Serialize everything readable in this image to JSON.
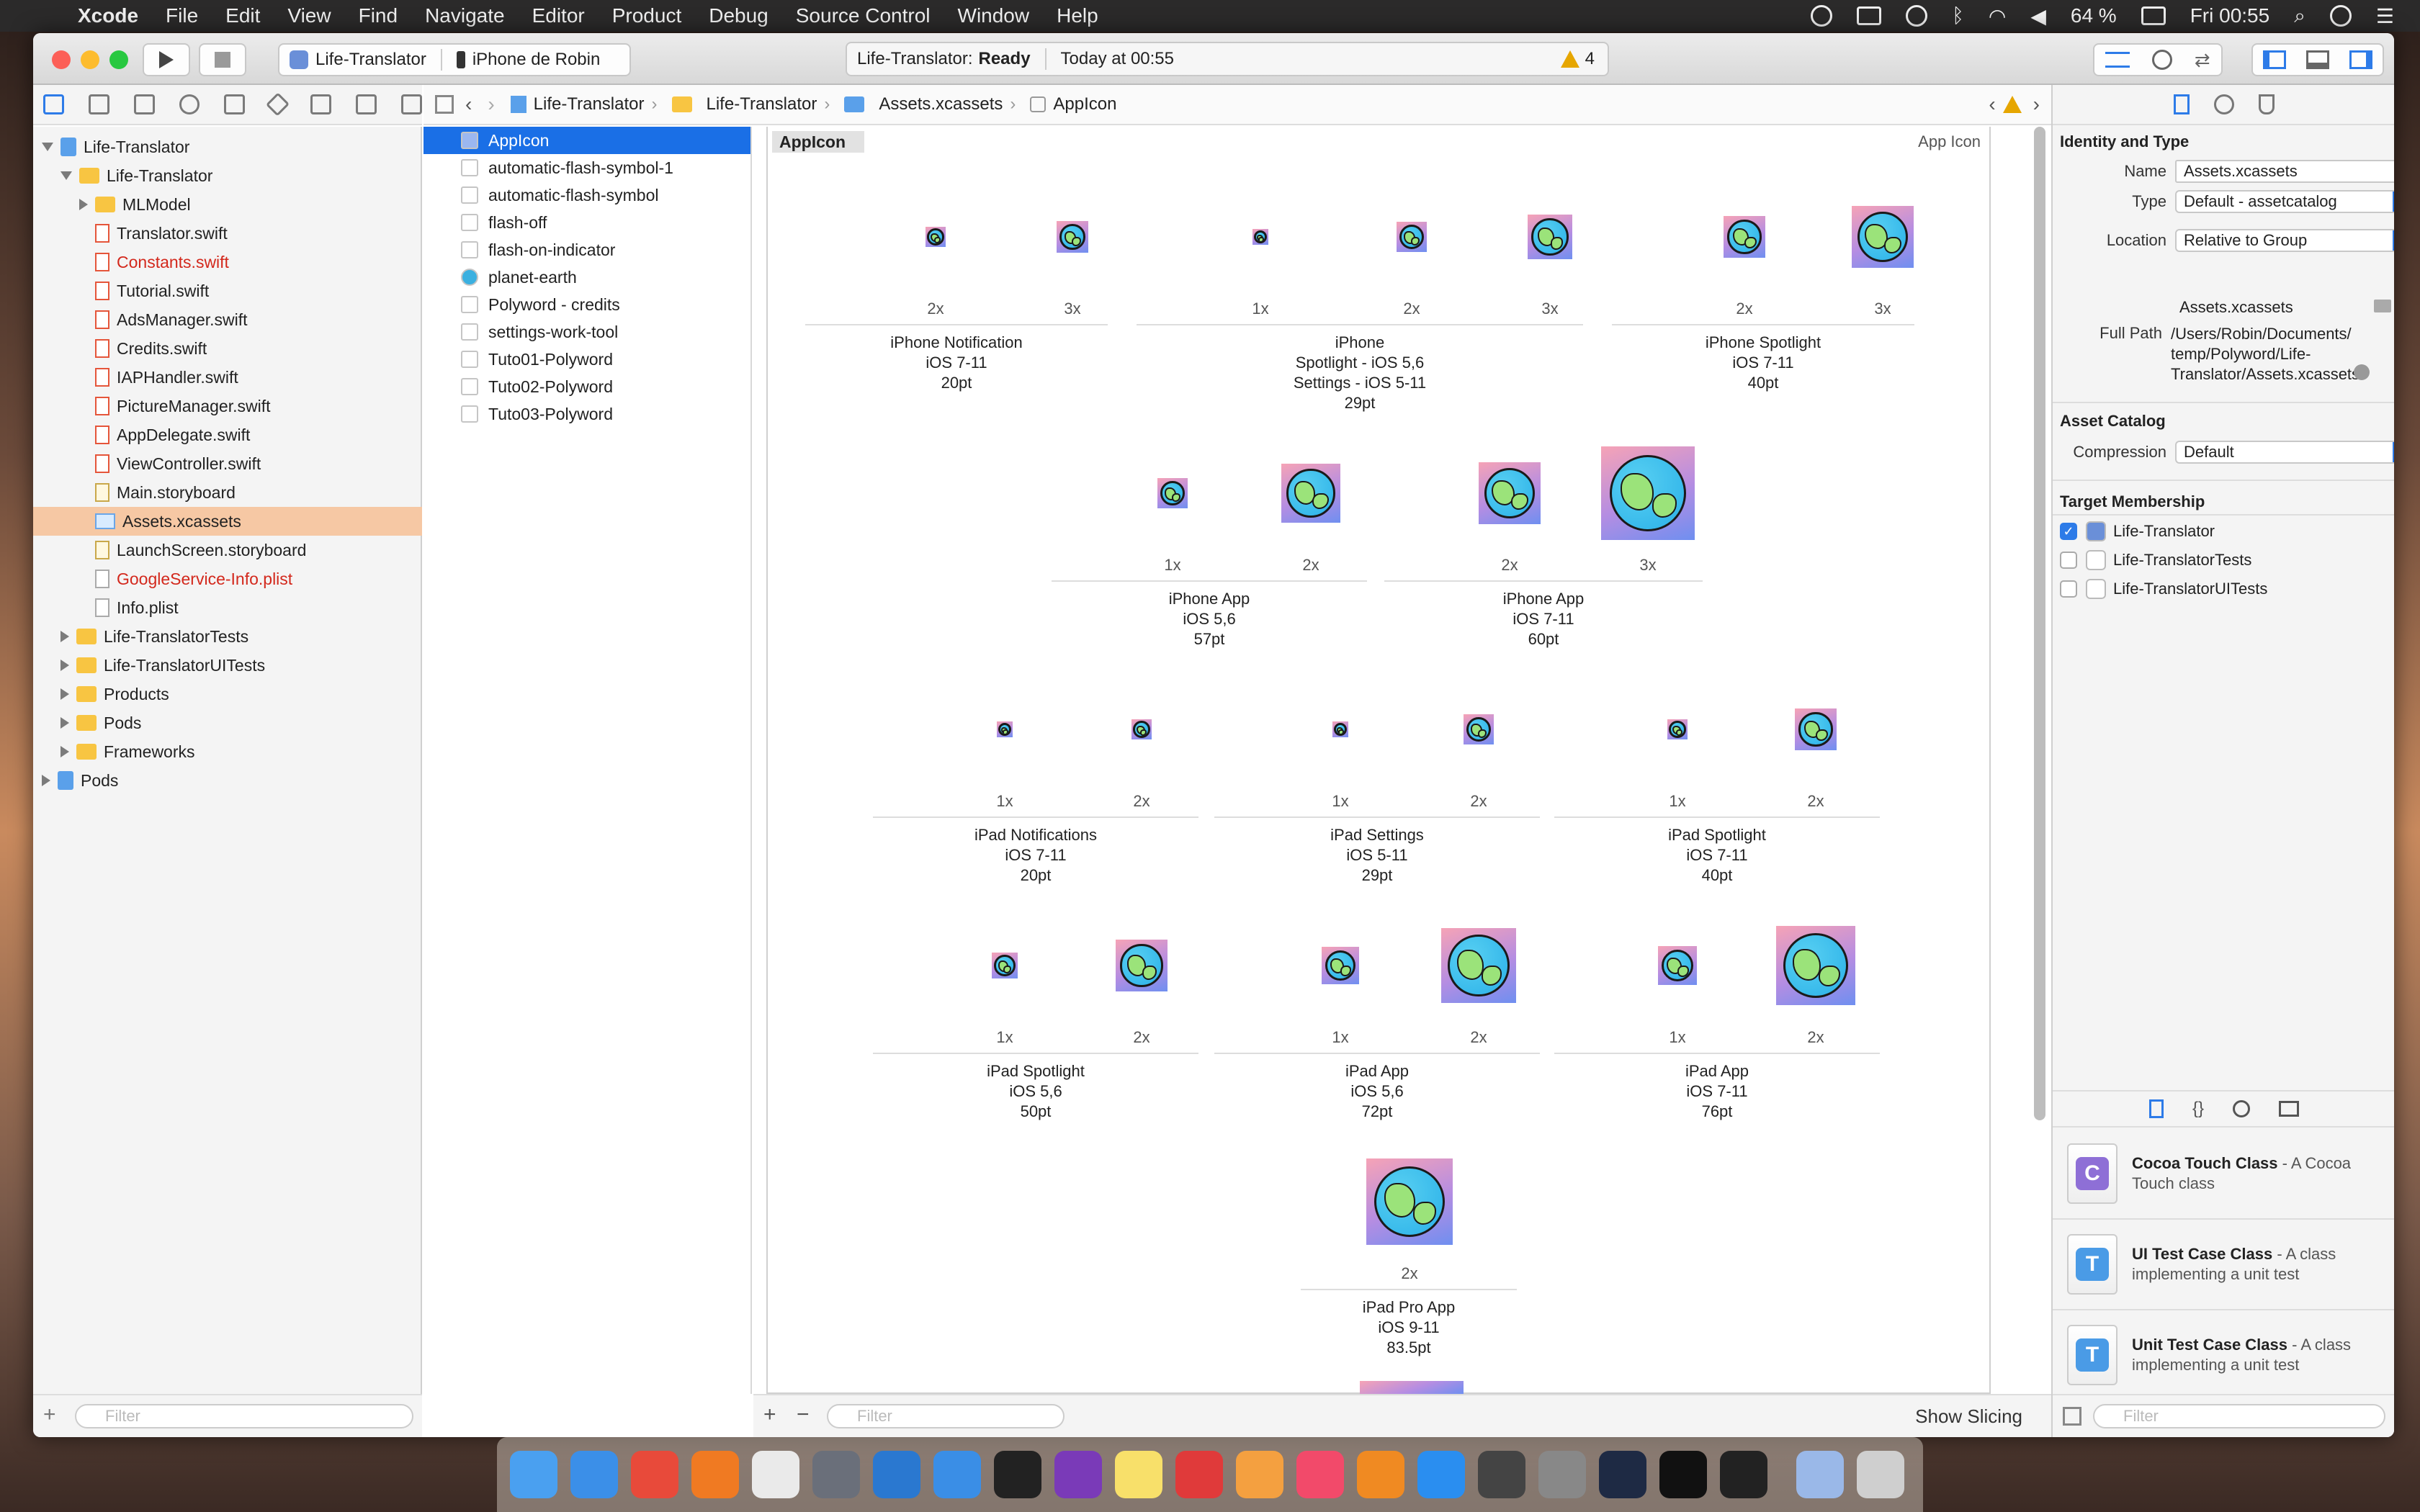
{
  "menubar": {
    "app": "Xcode",
    "items": [
      "File",
      "Edit",
      "View",
      "Find",
      "Navigate",
      "Editor",
      "Product",
      "Debug",
      "Source Control",
      "Window",
      "Help"
    ],
    "battery": "64 %",
    "clock": "Fri 00:55"
  },
  "toolbar": {
    "scheme": "Life-Translator",
    "device": "iPhone de Robin",
    "activity_project": "Life-Translator:",
    "activity_status": "Ready",
    "activity_time": "Today at 00:55",
    "warning_count": "4"
  },
  "navigator": {
    "rows": [
      {
        "label": "Life-Translator",
        "level": 0,
        "type": "project",
        "open": true
      },
      {
        "label": "Life-Translator",
        "level": 1,
        "type": "folder",
        "open": true
      },
      {
        "label": "MLModel",
        "level": 2,
        "type": "folder",
        "open": false
      },
      {
        "label": "Translator.swift",
        "level": 2,
        "type": "swift"
      },
      {
        "label": "Constants.swift",
        "level": 2,
        "type": "swift",
        "red": true
      },
      {
        "label": "Tutorial.swift",
        "level": 2,
        "type": "swift"
      },
      {
        "label": "AdsManager.swift",
        "level": 2,
        "type": "swift"
      },
      {
        "label": "Credits.swift",
        "level": 2,
        "type": "swift"
      },
      {
        "label": "IAPHandler.swift",
        "level": 2,
        "type": "swift"
      },
      {
        "label": "PictureManager.swift",
        "level": 2,
        "type": "swift"
      },
      {
        "label": "AppDelegate.swift",
        "level": 2,
        "type": "swift"
      },
      {
        "label": "ViewController.swift",
        "level": 2,
        "type": "swift"
      },
      {
        "label": "Main.storyboard",
        "level": 2,
        "type": "sb"
      },
      {
        "label": "Assets.xcassets",
        "level": 2,
        "type": "x",
        "selected": true
      },
      {
        "label": "LaunchScreen.storyboard",
        "level": 2,
        "type": "sb"
      },
      {
        "label": "GoogleService-Info.plist",
        "level": 2,
        "type": "file",
        "red": true
      },
      {
        "label": "Info.plist",
        "level": 2,
        "type": "file"
      },
      {
        "label": "Life-TranslatorTests",
        "level": 1,
        "type": "folder",
        "open": false
      },
      {
        "label": "Life-TranslatorUITests",
        "level": 1,
        "type": "folder",
        "open": false
      },
      {
        "label": "Products",
        "level": 1,
        "type": "folder",
        "open": false
      },
      {
        "label": "Pods",
        "level": 1,
        "type": "folder",
        "open": false
      },
      {
        "label": "Frameworks",
        "level": 1,
        "type": "folder",
        "open": false
      },
      {
        "label": "Pods",
        "level": 0,
        "type": "project",
        "open": false
      }
    ],
    "filter_placeholder": "Filter"
  },
  "jumpbar": {
    "crumbs": [
      "Life-Translator",
      "Life-Translator",
      "Assets.xcassets",
      "AppIcon"
    ]
  },
  "asset_sets": {
    "items": [
      "AppIcon",
      "automatic-flash-symbol-1",
      "automatic-flash-symbol",
      "flash-off",
      "flash-on-indicator",
      "planet-earth",
      "Polyword - credits",
      "settings-work-tool",
      "Tuto01-Polyword",
      "Tuto02-Polyword",
      "Tuto03-Polyword"
    ],
    "selected": 0,
    "filter_placeholder": "Filter"
  },
  "editor": {
    "set_name": "AppIcon",
    "set_type": "App Icon",
    "show_slicing": "Show Slicing",
    "groups": [
      {
        "label": "iPhone Notification\niOS 7-11\n20pt",
        "slots": [
          {
            "scale": "2x",
            "size": 40
          },
          {
            "scale": "3x",
            "size": 60
          }
        ]
      },
      {
        "label": "iPhone\nSpotlight - iOS 5,6\nSettings - iOS 5-11\n29pt",
        "slots": [
          {
            "scale": "1x",
            "size": 29
          },
          {
            "scale": "2x",
            "size": 58
          },
          {
            "scale": "3x",
            "size": 87
          }
        ]
      },
      {
        "label": "iPhone Spotlight\niOS 7-11\n40pt",
        "slots": [
          {
            "scale": "2x",
            "size": 80
          },
          {
            "scale": "3x",
            "size": 120
          }
        ]
      },
      {
        "label": "iPhone App\niOS 5,6\n57pt",
        "slots": [
          {
            "scale": "1x",
            "size": 57
          },
          {
            "scale": "2x",
            "size": 114
          }
        ]
      },
      {
        "label": "iPhone App\niOS 7-11\n60pt",
        "slots": [
          {
            "scale": "2x",
            "size": 120
          },
          {
            "scale": "3x",
            "size": 180
          }
        ]
      },
      {
        "label": "iPad Notifications\niOS 7-11\n20pt",
        "slots": [
          {
            "scale": "1x",
            "size": 20
          },
          {
            "scale": "2x",
            "size": 40
          }
        ]
      },
      {
        "label": "iPad Settings\niOS 5-11\n29pt",
        "slots": [
          {
            "scale": "1x",
            "size": 29
          },
          {
            "scale": "2x",
            "size": 58
          }
        ]
      },
      {
        "label": "iPad Spotlight\niOS 7-11\n40pt",
        "slots": [
          {
            "scale": "1x",
            "size": 40
          },
          {
            "scale": "2x",
            "size": 80
          }
        ]
      },
      {
        "label": "iPad Spotlight\niOS 5,6\n50pt",
        "slots": [
          {
            "scale": "1x",
            "size": 50
          },
          {
            "scale": "2x",
            "size": 100
          }
        ]
      },
      {
        "label": "iPad App\niOS 5,6\n72pt",
        "slots": [
          {
            "scale": "1x",
            "size": 72
          },
          {
            "scale": "2x",
            "size": 144
          }
        ]
      },
      {
        "label": "iPad App\niOS 7-11\n76pt",
        "slots": [
          {
            "scale": "1x",
            "size": 76
          },
          {
            "scale": "2x",
            "size": 152
          }
        ]
      },
      {
        "label": "iPad Pro App\niOS 9-11\n83.5pt",
        "slots": [
          {
            "scale": "2x",
            "size": 167
          }
        ]
      }
    ]
  },
  "inspector": {
    "identity_title": "Identity and Type",
    "name_label": "Name",
    "name_value": "Assets.xcassets",
    "type_label": "Type",
    "type_value": "Default - assetcatalog",
    "location_label": "Location",
    "location_value": "Relative to Group",
    "location_file": "Assets.xcassets",
    "fullpath_label": "Full Path",
    "fullpath_value": "/Users/Robin/Documents/\ntemp/Polyword/Life-\nTranslator/Assets.xcassets",
    "catalog_title": "Asset Catalog",
    "compression_label": "Compression",
    "compression_value": "Default",
    "membership_title": "Target Membership",
    "targets": [
      {
        "label": "Life-Translator",
        "checked": true
      },
      {
        "label": "Life-TranslatorTests",
        "checked": false
      },
      {
        "label": "Life-TranslatorUITests",
        "checked": false
      }
    ],
    "library": [
      {
        "title": "Cocoa Touch Class",
        "desc": "A Cocoa Touch class",
        "letter": "C",
        "color": "#8e6fd6"
      },
      {
        "title": "UI Test Case Class",
        "desc": "A class implementing a unit test",
        "letter": "T",
        "color": "#4a9be6"
      },
      {
        "title": "Unit Test Case Class",
        "desc": "A class implementing a unit test",
        "letter": "T",
        "color": "#4a9be6"
      }
    ],
    "filter_placeholder": "Filter"
  }
}
